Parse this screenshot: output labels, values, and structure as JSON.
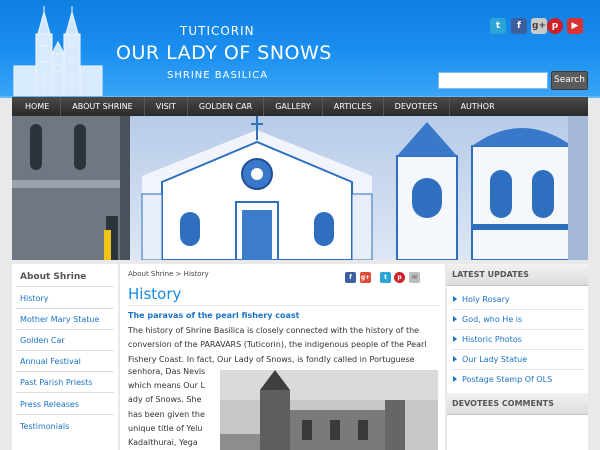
{
  "header": {
    "brand_top": "TUTICORIN",
    "brand_title": "OUR LADY OF SNOWS",
    "brand_bottom": "SHRINE BASILICA",
    "social": [
      {
        "icon": "twitter-icon",
        "glyph": "t"
      },
      {
        "icon": "facebook-icon",
        "glyph": "f"
      },
      {
        "icon": "google-plus-icon",
        "glyph": "g+"
      },
      {
        "icon": "pinterest-icon",
        "glyph": "p"
      },
      {
        "icon": "youtube-icon",
        "glyph": "▶"
      }
    ],
    "search": {
      "placeholder": "",
      "value": "",
      "button_label": "Search"
    }
  },
  "nav": {
    "items": [
      "HOME",
      "ABOUT SHRINE",
      "VISIT",
      "GOLDEN CAR",
      "GALLERY",
      "ARTICLES",
      "DEVOTEES",
      "AUTHOR"
    ]
  },
  "sidebar": {
    "heading": "About Shrine",
    "items": [
      "History",
      "Mother Mary Statue",
      "Golden Car",
      "Annual Festival",
      "Past Parish Priests",
      "Press Releases",
      "Testimonials"
    ]
  },
  "main": {
    "breadcrumb": "About Shrine > History",
    "share": [
      {
        "icon": "facebook-share-icon",
        "glyph": "f"
      },
      {
        "icon": "google-plus-share-icon",
        "glyph": "g+"
      },
      {
        "icon": "twitter-share-icon",
        "glyph": "t"
      },
      {
        "icon": "pinterest-share-icon",
        "glyph": "p"
      },
      {
        "icon": "email-share-icon",
        "glyph": "✉"
      }
    ],
    "title": "History",
    "subheading": "The paravas of the pearl fishery coast",
    "para_lines": [
      "The history of Shrine Basilica is closely connected with the history of the",
      "conversion of the PARAVARS (Tuticorin), the indigenous people of the Pearl",
      "Fishery Coast. In fact, Our Lady of Snows, is fondly called in Portuguese"
    ],
    "narrow_lines": [
      "senhora, Das Nevis",
      "which means Our L",
      "ady of Snows. She",
      "has been given the",
      "unique title of Yelu",
      "Kadalthurai, Yega"
    ]
  },
  "right": {
    "latest_heading": "LATEST UPDATES",
    "latest_items": [
      "Holy Rosary",
      "God, who He is",
      "Historic Photos",
      "Our Lady Statue",
      "Postage Stamp Of OLS"
    ],
    "comments_heading": "DEVOTEES COMMENTS"
  },
  "colors": {
    "header_blue": "#1b8ff0",
    "link_blue": "#1a73c7",
    "title_blue": "#1a8ae0",
    "nav_dark": "#2a2a2a"
  }
}
